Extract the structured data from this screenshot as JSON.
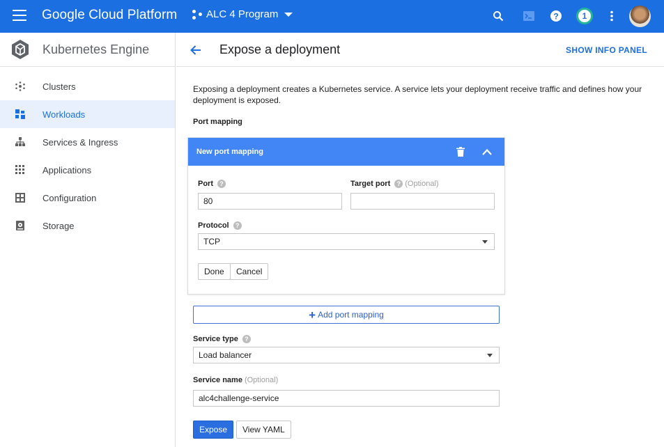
{
  "topbar": {
    "brand": "Google Cloud Platform",
    "project": "ALC 4 Program",
    "notification_count": "1"
  },
  "sidebar": {
    "title": "Kubernetes Engine",
    "items": [
      {
        "label": "Clusters",
        "icon": "clusters-icon"
      },
      {
        "label": "Workloads",
        "icon": "workloads-icon"
      },
      {
        "label": "Services & Ingress",
        "icon": "services-icon"
      },
      {
        "label": "Applications",
        "icon": "applications-icon"
      },
      {
        "label": "Configuration",
        "icon": "configuration-icon"
      },
      {
        "label": "Storage",
        "icon": "storage-icon"
      }
    ],
    "active": "Workloads"
  },
  "header": {
    "title": "Expose a deployment",
    "info_panel": "SHOW INFO PANEL"
  },
  "description": "Exposing a deployment creates a Kubernetes service. A service lets your deployment receive traffic and defines how your deployment is exposed.",
  "port_mapping": {
    "section_label": "Port mapping",
    "card_title": "New port mapping",
    "port_label": "Port",
    "port_value": "80",
    "target_port_label": "Target port",
    "target_port_optional": "(Optional)",
    "target_port_value": "",
    "protocol_label": "Protocol",
    "protocol_value": "TCP",
    "done": "Done",
    "cancel": "Cancel",
    "add_label": "Add port mapping"
  },
  "service": {
    "type_label": "Service type",
    "type_value": "Load balancer",
    "name_label": "Service name",
    "name_optional": "(Optional)",
    "name_value": "alc4challenge-service"
  },
  "actions": {
    "expose": "Expose",
    "view_yaml": "View YAML"
  },
  "colors": {
    "topbar": "#1c6fe0",
    "card_header": "#4285f4",
    "badge_ring": "#27b59a"
  }
}
